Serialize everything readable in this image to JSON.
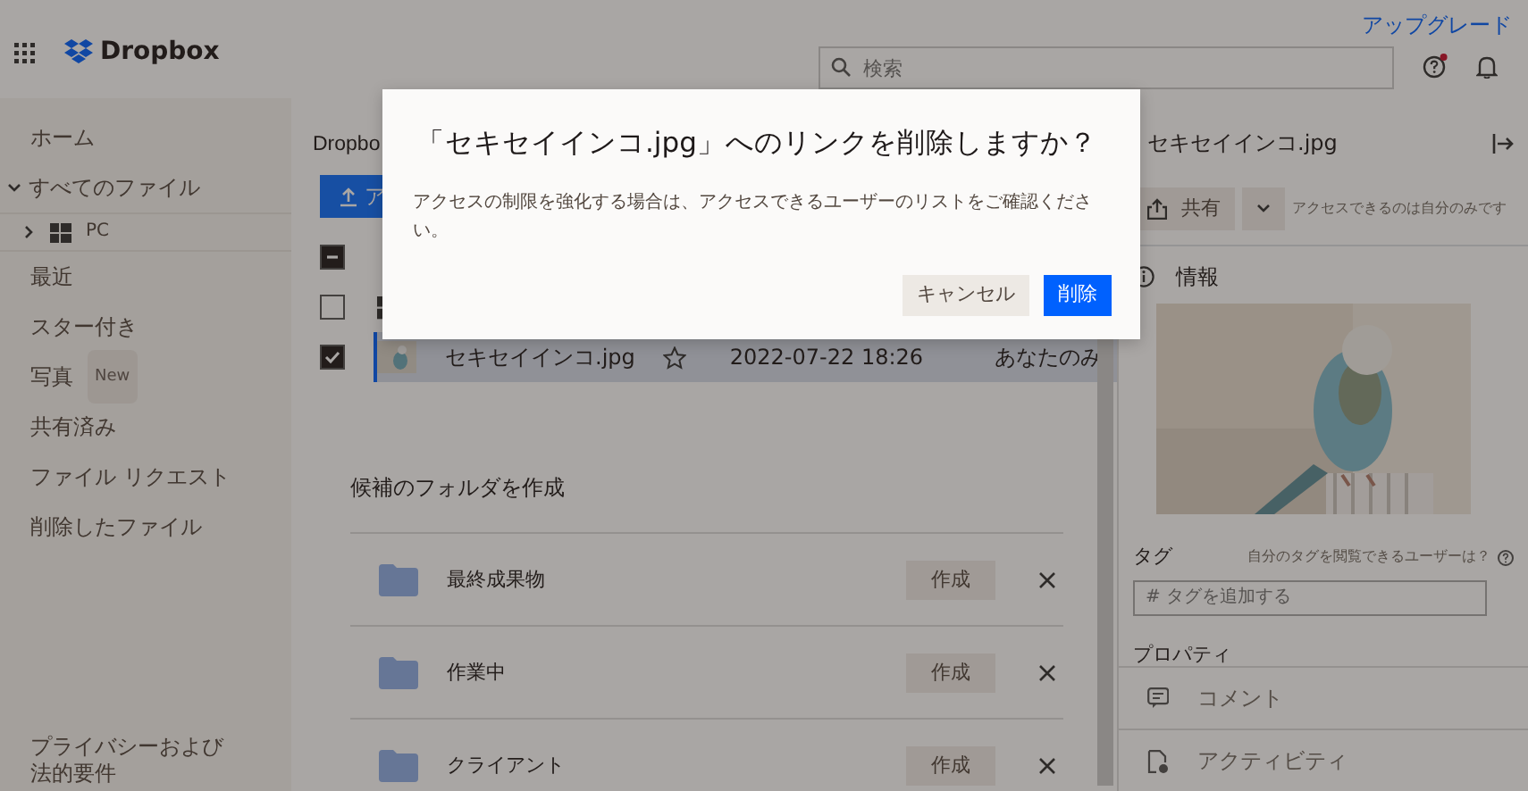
{
  "header": {
    "logo": "Dropbox",
    "search": {
      "placeholder": "検索"
    },
    "help_notification": true,
    "upgrade": "アップグレード"
  },
  "sidebar": {
    "items": [
      {
        "label": "ホーム"
      },
      {
        "label": "すべてのファイル",
        "expanded": true,
        "children": [
          {
            "label": "PC",
            "expanded": false
          }
        ]
      },
      {
        "label": "最近"
      },
      {
        "label": "スター付き"
      },
      {
        "label": "写真",
        "badge": "New"
      },
      {
        "label": "共有済み"
      },
      {
        "label": "ファイル リクエスト"
      },
      {
        "label": "削除したファイル"
      }
    ],
    "footer": "プライバシーおよび法的要件"
  },
  "main": {
    "breadcrumb": "Dropbo",
    "upload_button": "ア",
    "list_header": {
      "indeterminate": true
    },
    "rows": [
      {
        "kind": "windows",
        "checked": false,
        "selected": false
      },
      {
        "name": "セキセイインコ.jpg",
        "starred": false,
        "modified": "2022-07-22 18:26",
        "access": "あなたのみ",
        "checked": true,
        "selected": true
      }
    ],
    "suggested": {
      "title": "候補のフォルダを作成",
      "folders": [
        {
          "name": "最終成果物",
          "button": "作成"
        },
        {
          "name": "作業中",
          "button": "作成"
        },
        {
          "name": "クライアント",
          "button": "作成"
        }
      ]
    }
  },
  "details": {
    "title": "セキセイインコ.jpg",
    "share_button": "共有",
    "access_note": "アクセスできるのは自分のみです",
    "info": "情報",
    "tags_label": "タグ",
    "tags_help": "自分のタグを閲覧できるユーザーは？",
    "tag_input": {
      "placeholder": "# タグを追加する"
    },
    "properties": "プロパティ",
    "sections": [
      {
        "kind": "comment",
        "label": "コメント"
      },
      {
        "kind": "activity",
        "label": "アクティビティ"
      }
    ]
  },
  "dialog": {
    "title": "「セキセイインコ.jpg」へのリンクを削除しますか？",
    "body": "アクセスの制限を強化する場合は、アクセスできるユーザーのリストをご確認ください。",
    "buttons": [
      {
        "label": "キャンセル",
        "kind": "secondary"
      },
      {
        "label": "削除",
        "kind": "primary"
      }
    ]
  }
}
